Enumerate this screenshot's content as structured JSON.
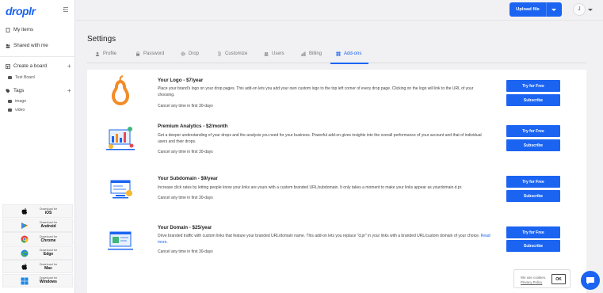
{
  "app": {
    "logo": "droplr"
  },
  "sidebar": {
    "items": [
      {
        "label": "My items",
        "icon": "file-icon"
      },
      {
        "label": "Shared with me",
        "icon": "people-icon"
      },
      {
        "label": "Create a board",
        "icon": "board-icon"
      }
    ],
    "boards": [
      "Test Board"
    ],
    "tags_label": "Tags",
    "tags": [
      "image",
      "video"
    ],
    "downloads": [
      {
        "prefix": "Download for",
        "platform": "iOS",
        "icon": "apple-icon"
      },
      {
        "prefix": "Download for",
        "platform": "Android",
        "icon": "android-icon"
      },
      {
        "prefix": "Download for",
        "platform": "Chrome",
        "icon": "chrome-icon"
      },
      {
        "prefix": "Download for",
        "platform": "Edge",
        "icon": "edge-icon"
      },
      {
        "prefix": "Download for",
        "platform": "Mac",
        "icon": "apple-icon"
      },
      {
        "prefix": "Download for",
        "platform": "Windows",
        "icon": "windows-icon"
      }
    ]
  },
  "header": {
    "upload_label": "Upload file",
    "avatar_initial": "J"
  },
  "page": {
    "title": "Settings"
  },
  "tabs": [
    {
      "label": "Profile",
      "icon": "user-icon"
    },
    {
      "label": "Password",
      "icon": "lock-icon"
    },
    {
      "label": "Drop",
      "icon": "gear-icon"
    },
    {
      "label": "Customize",
      "icon": "sliders-icon"
    },
    {
      "label": "Users",
      "icon": "users-icon"
    },
    {
      "label": "Billing",
      "icon": "bars-icon"
    },
    {
      "label": "Add-ons",
      "icon": "addons-icon",
      "active": true
    }
  ],
  "addons": [
    {
      "name": "Your Logo - $7/year",
      "desc": "Place your brand's logo on your drop pages. This add-on lets you add your own custom logo to the top left corner of every drop page. Clicking on the logo will link to the URL of your choosing.",
      "more": "",
      "cancel": "Cancel any time in first 30-days",
      "try_label": "Try for Free",
      "subscribe_label": "Subscribe"
    },
    {
      "name": "Premium Analytics - $2/month",
      "desc": "Get a deeper understanding of your drops and the analysis you need for your business. Powerful add-on gives insights into the overall performance of your account and that of individual users and their drops.",
      "more": "",
      "cancel": "Cancel any time in first 30-days",
      "try_label": "Try for Free",
      "subscribe_label": "Subscribe"
    },
    {
      "name": "Your Subdomain - $9/year",
      "desc": "Increase click rates by letting people know your links are yours with a custom branded URL/subdomain. It only takes a moment to make your links appear as yourdomain.d.pr.",
      "more": "",
      "cancel": "Cancel any time in first 30-days",
      "try_label": "Try for Free",
      "subscribe_label": "Subscribe"
    },
    {
      "name": "Your Domain - $25/year",
      "desc": "Drive branded traffic with custom links that feature your branded URL/domain name. This add-on lets you replace \"d.pr\" in your links with a branded URL/custom domain of your choice.",
      "more": "Read more.",
      "cancel": "Cancel any time in first 30-days",
      "try_label": "Try for Free",
      "subscribe_label": "Subscribe"
    }
  ],
  "cookie": {
    "line1": "We use cookies.",
    "line2": "Privacy Policy",
    "ok": "OK"
  },
  "colors": {
    "accent": "#1b64f2",
    "pear": "#f28c28"
  }
}
